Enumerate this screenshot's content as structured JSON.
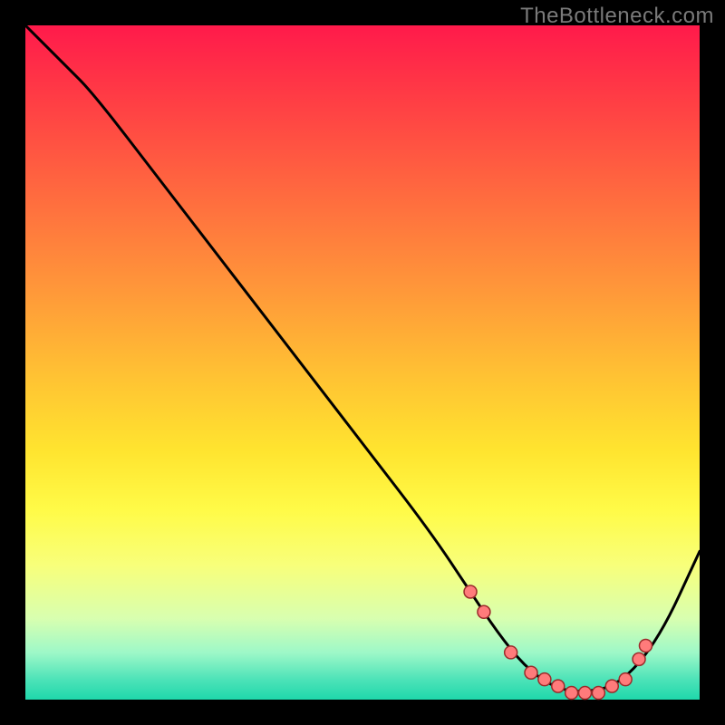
{
  "watermark": "TheBottleneck.com",
  "colors": {
    "frame": "#000000",
    "dot_fill": "#ff7b7b",
    "dot_stroke": "#9c2b2b",
    "curve": "#000000"
  },
  "chart_data": {
    "type": "line",
    "title": "",
    "xlabel": "",
    "ylabel": "",
    "xlim": [
      0,
      100
    ],
    "ylim": [
      0,
      100
    ],
    "grid": false,
    "series": [
      {
        "name": "bottleneck-curve",
        "x": [
          0,
          6,
          10,
          20,
          30,
          40,
          50,
          60,
          66,
          70,
          74,
          78,
          82,
          88,
          94,
          100
        ],
        "y": [
          100,
          94,
          90,
          77,
          64,
          51,
          38,
          25,
          16,
          10,
          5,
          2,
          1,
          2,
          9,
          22
        ]
      }
    ],
    "markers": {
      "name": "highlight-dots",
      "x": [
        66,
        68,
        72,
        75,
        77,
        79,
        81,
        83,
        85,
        87,
        89,
        91,
        92
      ],
      "y": [
        16,
        13,
        7,
        4,
        3,
        2,
        1,
        1,
        1,
        2,
        3,
        6,
        8
      ]
    }
  }
}
